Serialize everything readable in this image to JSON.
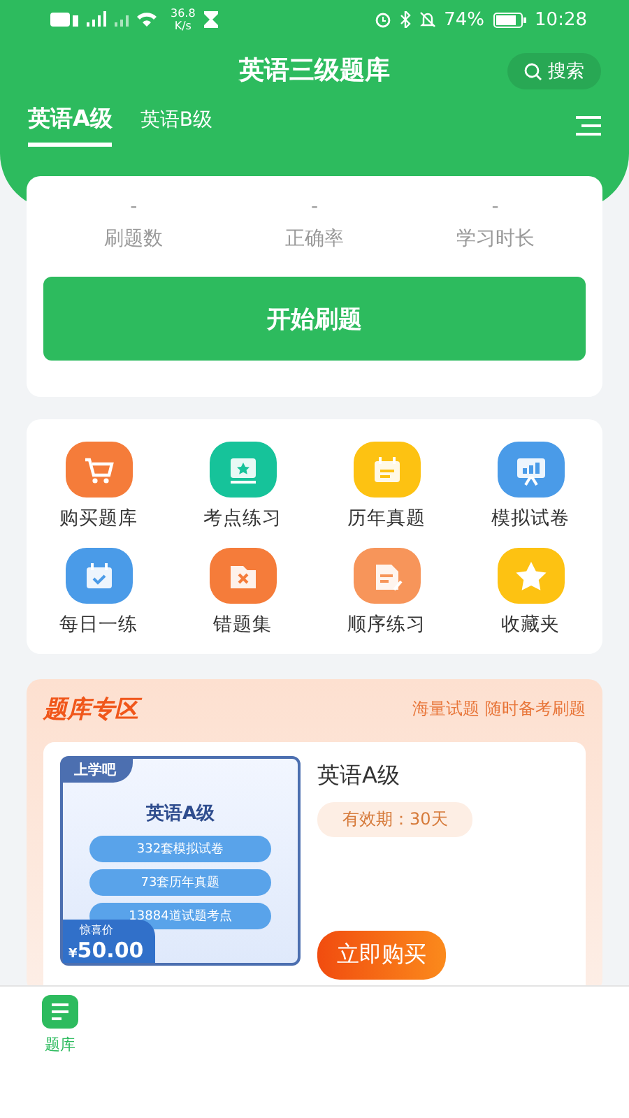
{
  "status_bar": {
    "speed_value": "36.8",
    "speed_unit": "K/s",
    "battery": "74%",
    "time": "10:28"
  },
  "header": {
    "title": "英语三级题库",
    "search_label": "搜索"
  },
  "tabs": [
    {
      "label": "英语A级",
      "selected": true
    },
    {
      "label": "英语B级",
      "selected": false
    }
  ],
  "stats": [
    {
      "value": "-",
      "label": "刷题数"
    },
    {
      "value": "-",
      "label": "正确率"
    },
    {
      "value": "-",
      "label": "学习时长"
    }
  ],
  "start_button": "开始刷题",
  "features": [
    {
      "label": "购买题库",
      "kind": "cart",
      "color": "#f57c3a"
    },
    {
      "label": "考点练习",
      "kind": "star-board",
      "color": "#16c39a"
    },
    {
      "label": "历年真题",
      "kind": "calendar",
      "color": "#fdc212"
    },
    {
      "label": "模拟试卷",
      "kind": "chart-board",
      "color": "#4a9be8"
    },
    {
      "label": "每日一练",
      "kind": "check-calendar",
      "color": "#4a9be8"
    },
    {
      "label": "错题集",
      "kind": "wrong-folder",
      "color": "#f57c3a"
    },
    {
      "label": "顺序练习",
      "kind": "note",
      "color": "#f7955a"
    },
    {
      "label": "收藏夹",
      "kind": "star",
      "color": "#fdc212"
    }
  ],
  "promo": {
    "title": "题库专区",
    "slogan": "海量试题 随时备考刷题",
    "product": {
      "cover": {
        "brand": "上学吧",
        "title": "英语A级",
        "lines": [
          "332套模拟试卷",
          "73套历年真题",
          "13884道试题考点"
        ],
        "price_label": "惊喜价",
        "currency": "¥",
        "price": "50.00"
      },
      "name": "英语A级",
      "validity": "有效期：30天",
      "buy_button": "立即购买"
    }
  },
  "bottom_nav": [
    {
      "label": "题库",
      "selected": true
    }
  ]
}
